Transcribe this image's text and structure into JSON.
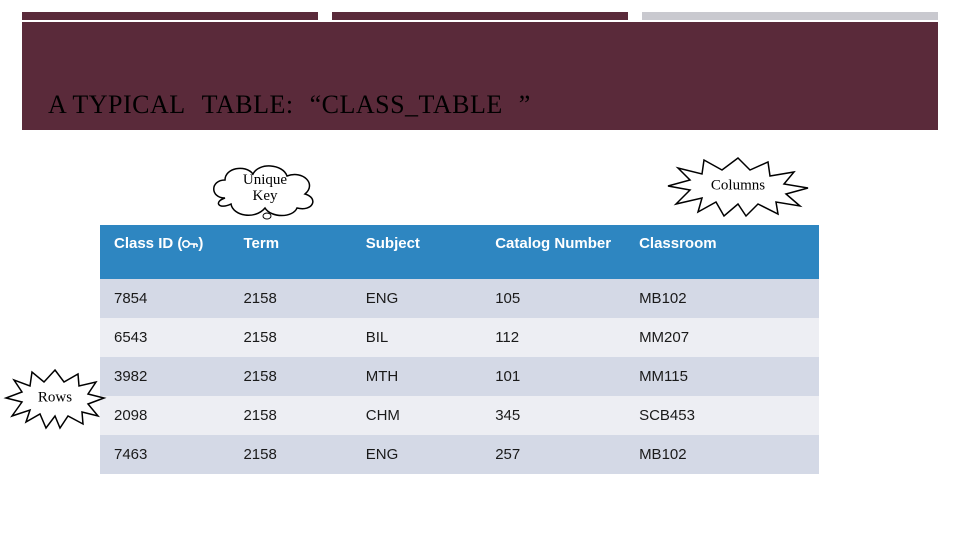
{
  "title": {
    "prefix": "A TYPICAL",
    "mid": "TABLE:",
    "name": "“CLASS_TABLE",
    "suffix": "”"
  },
  "callouts": {
    "unique_key": "Unique\nKey",
    "columns": "Columns",
    "rows": "Rows"
  },
  "table": {
    "headers": {
      "class_id": "Class ID",
      "term": "Term",
      "subject": "Subject",
      "catalog": "Catalog Number",
      "classroom": "Classroom"
    },
    "rows": [
      {
        "class_id": "7854",
        "term": "2158",
        "subject": "ENG",
        "catalog": "105",
        "classroom": "MB102"
      },
      {
        "class_id": "6543",
        "term": "2158",
        "subject": "BIL",
        "catalog": "112",
        "classroom": "MM207"
      },
      {
        "class_id": "3982",
        "term": "2158",
        "subject": "MTH",
        "catalog": "101",
        "classroom": "MM115"
      },
      {
        "class_id": "2098",
        "term": "2158",
        "subject": "CHM",
        "catalog": "345",
        "classroom": "SCB453"
      },
      {
        "class_id": "7463",
        "term": "2158",
        "subject": "ENG",
        "catalog": "257",
        "classroom": "MB102"
      }
    ]
  }
}
